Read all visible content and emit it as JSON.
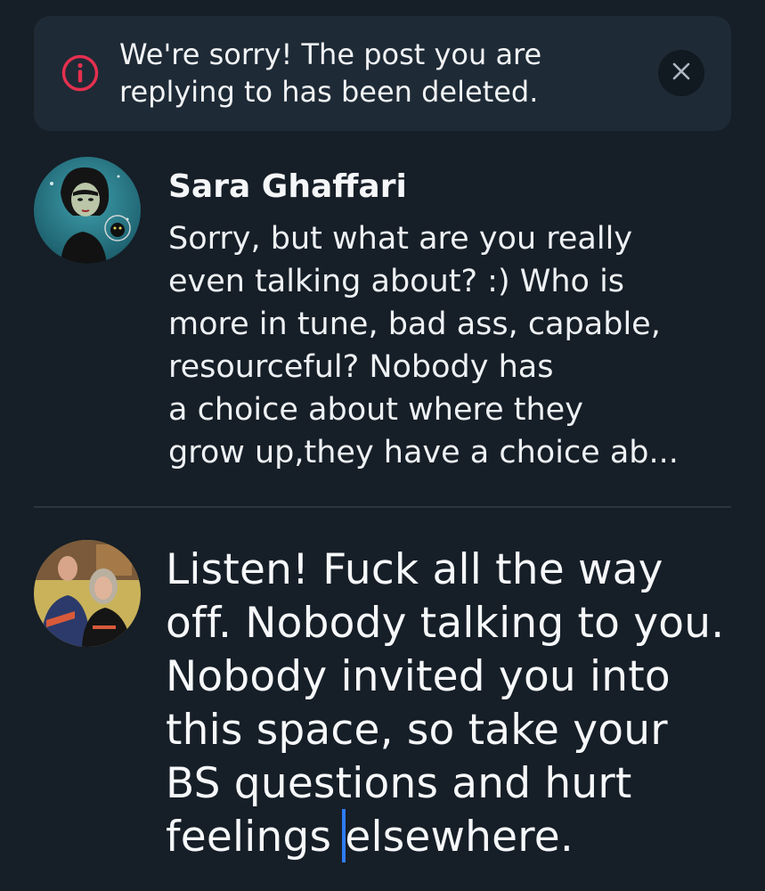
{
  "alert": {
    "message_line1": "We're sorry! The post you are",
    "message_line2": "replying to has been deleted.",
    "icon": "info-circle-icon",
    "icon_color": "#e5304f",
    "close_icon": "close-icon"
  },
  "quoted_post": {
    "author_name": "Sara Ghaffari",
    "text": "Sorry, but what are you really\neven talking about? :) Who is\nmore in tune, bad ass, capable,\nresourceful? Nobody has\na choice about where they\ngrow up,they have a choice ab..."
  },
  "composer": {
    "text": "Listen! Fuck all the way\noff. Nobody talking to you.\nNobody invited you into\nthis space, so take your\nBS questions and hurt\nfeelings elsewhere.",
    "caret_color": "#2f7bf5"
  },
  "colors": {
    "background": "#161e27",
    "banner": "#1e2a36",
    "divider": "#2a3542"
  }
}
